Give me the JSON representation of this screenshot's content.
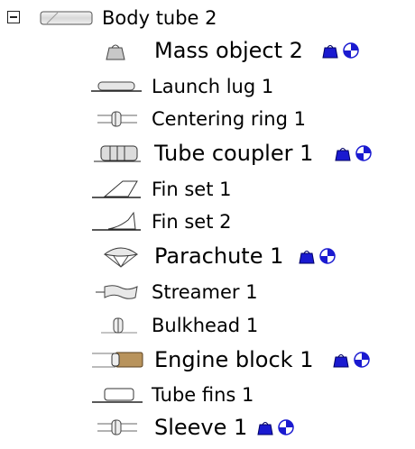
{
  "tree": {
    "items": [
      {
        "label": "Body tube 2",
        "icon": "body-tube-icon"
      },
      {
        "label": "Mass object 2",
        "icon": "mass-object-icon",
        "overrides": true
      },
      {
        "label": "Launch lug 1",
        "icon": "launch-lug-icon"
      },
      {
        "label": "Centering ring 1",
        "icon": "centering-ring-icon"
      },
      {
        "label": "Tube coupler 1",
        "icon": "tube-coupler-icon",
        "overrides": true
      },
      {
        "label": "Fin set 1",
        "icon": "trapezoid-fin-set-icon"
      },
      {
        "label": "Fin set 2",
        "icon": "freeform-fin-set-icon"
      },
      {
        "label": "Parachute 1",
        "icon": "parachute-icon",
        "overrides": true
      },
      {
        "label": "Streamer 1",
        "icon": "streamer-icon"
      },
      {
        "label": "Bulkhead 1",
        "icon": "bulkhead-icon"
      },
      {
        "label": "Engine block 1",
        "icon": "engine-block-icon",
        "overrides": true
      },
      {
        "label": "Tube fins 1",
        "icon": "tube-fins-icon"
      },
      {
        "label": "Sleeve 1",
        "icon": "sleeve-icon",
        "overrides": true
      }
    ],
    "badge_icons": [
      "mass-override-icon",
      "cg-override-icon"
    ],
    "colors": {
      "badge_blue": "#1a1ad0",
      "text": "#000000"
    }
  }
}
